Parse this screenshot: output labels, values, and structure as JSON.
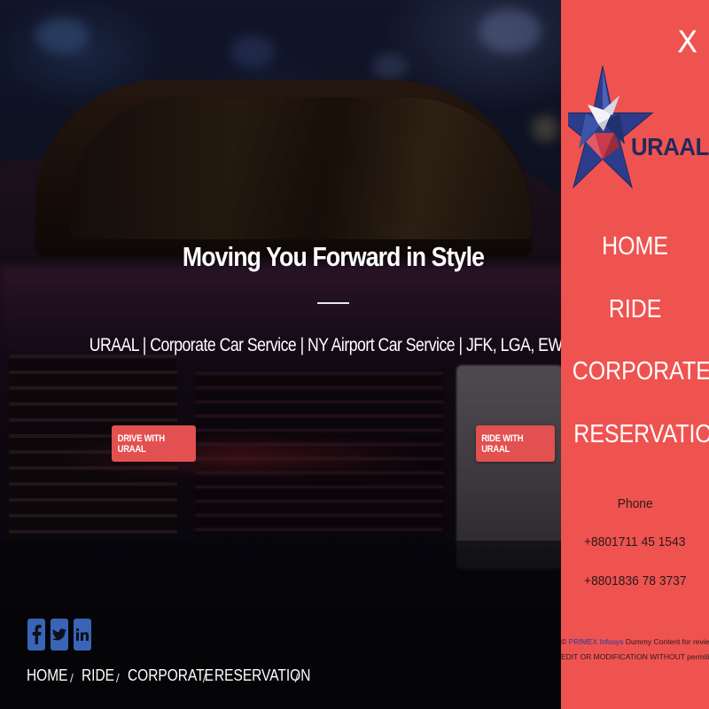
{
  "hero": {
    "title": "Moving You Forward in Style",
    "subtitle": "URAAL | Corporate Car Service | NY Airport Car Service | JFK, LGA, EWR.",
    "cta_drive": "DRIVE WITH URAAL",
    "cta_ride": "RIDE WITH URAAL"
  },
  "footer": {
    "social": [
      {
        "icon": "facebook-icon"
      },
      {
        "icon": "twitter-icon"
      },
      {
        "icon": "linkedin-icon"
      }
    ],
    "nav": [
      {
        "label": "HOME"
      },
      {
        "label": "RIDE"
      },
      {
        "label": "CORPORATE"
      },
      {
        "label": "RESERVATION"
      }
    ],
    "separator": "/"
  },
  "panel": {
    "close_label": "X",
    "logo_text": "URAAL",
    "nav": [
      {
        "label": "HOME"
      },
      {
        "label": "RIDE"
      },
      {
        "label": "CORPORATE"
      },
      {
        "label": "RESERVATION"
      }
    ],
    "phone_label": "Phone",
    "phones": [
      "+8801711 45 1543",
      "+8801836 78 3737"
    ],
    "copyright_symbol": "©",
    "copyright_brand": "PRIMEX Infosys",
    "copyright_line1_rest": "Dummy Content for review DO NOT COPY",
    "copyright_line2": "EDIT OR MODIFICATION WITHOUT permition of auth: ."
  },
  "colors": {
    "panel_bg": "#ef5350",
    "cta_bg": "#e2504f",
    "logo_navy": "#1f2a5c",
    "social_blue": "#3a64b5"
  }
}
